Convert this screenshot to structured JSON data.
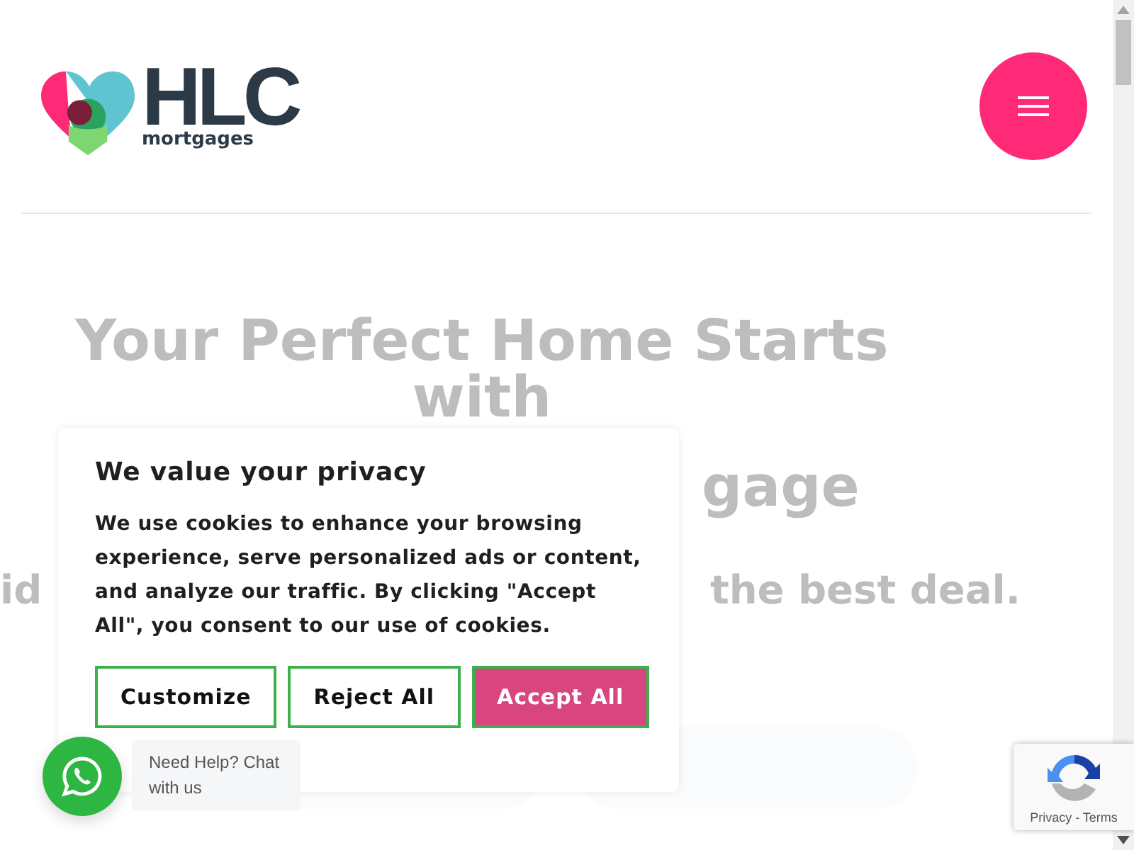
{
  "header": {
    "logo": {
      "wordmark": "HLC",
      "tagline": "mortgages"
    }
  },
  "hero": {
    "heading_line_1": "Your Perfect Home Starts",
    "heading_line_2": "with",
    "heading_line_3": "gage",
    "subtitle_left": "id",
    "subtitle_right": "the best deal."
  },
  "cookie_dialog": {
    "title": "We value your privacy",
    "text": "We use cookies to enhance your browsing experience, serve personalized ads or content, and analyze our traffic. By clicking \"Accept All\", you consent to our use of cookies.",
    "buttons": [
      {
        "label": "Customize",
        "kind": "outline"
      },
      {
        "label": "Reject All",
        "kind": "outline"
      },
      {
        "label": "Accept All",
        "kind": "primary"
      }
    ]
  },
  "chat_widget": {
    "text": "Need Help? Chat with us"
  },
  "recaptcha": {
    "links": "Privacy - Terms"
  }
}
